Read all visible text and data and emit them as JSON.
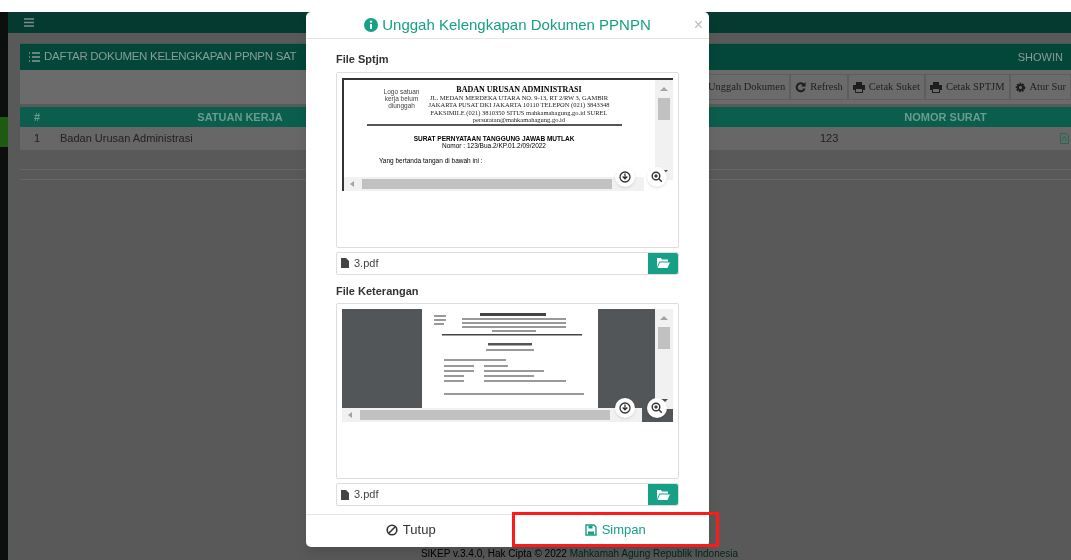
{
  "panel": {
    "title": "DAFTAR DOKUMEN KELENGKAPAN PPNPN SAT",
    "showing": "SHOWIN"
  },
  "toolbar": [
    {
      "label": "Unggah Dokumen",
      "kind": "upload"
    },
    {
      "label": "Refresh",
      "kind": "refresh"
    },
    {
      "label": "Cetak Suket",
      "kind": "print"
    },
    {
      "label": "Cetak SPTJM",
      "kind": "print"
    },
    {
      "label": "Atur Sur",
      "kind": "gear"
    }
  ],
  "table": {
    "columns": [
      "#",
      "SATUAN KERJA",
      "NOMOR SURAT"
    ],
    "rows": [
      {
        "number": "1",
        "satuan_kerja": "Badan Urusan Administrasi",
        "nomor_surat": "123"
      }
    ]
  },
  "footer": {
    "text": "SIKEP v.3.4.0, Hak Cipta © 2022 ",
    "link": "Mahkamah Agung Republik Indonesia"
  },
  "modal": {
    "title": "Unggah Kelengkapan Dokumen PPNPN",
    "close": "×",
    "files": [
      {
        "label": "File Sptjm",
        "file_name": "3.pdf",
        "document": {
          "logo_note": "Logo satuan kerja belum diunggah",
          "org": "BADAN URUSAN ADMINISTRASI",
          "address": [
            "JL. MEDAN MERDEKA UTARA NO. 9-13, RT 2/RW 3, GAMBIR",
            "JAKARTA PUSAT DKI JAKARTA 10110 TELEPON (021) 3843348",
            "FAKSIMILE (021) 3810350 SITUS mahkamahagung.go.id SUREL",
            "persuratan@mahkamahagung.go.id"
          ],
          "title": "SURAT PERNYATAAN TANGGUNG JAWAB MUTLAK",
          "number": "Nomor : 123/Bua.2/KP.01.2/09/2022",
          "body": [
            "Yang bertanda tangan di bawah ini :"
          ]
        }
      },
      {
        "label": "File Keterangan",
        "file_name": "3.pdf"
      }
    ],
    "buttons": [
      {
        "label": "Tutup",
        "kind": "close",
        "highlighted": false
      },
      {
        "label": "Simpan",
        "kind": "save",
        "highlighted": true
      }
    ]
  }
}
